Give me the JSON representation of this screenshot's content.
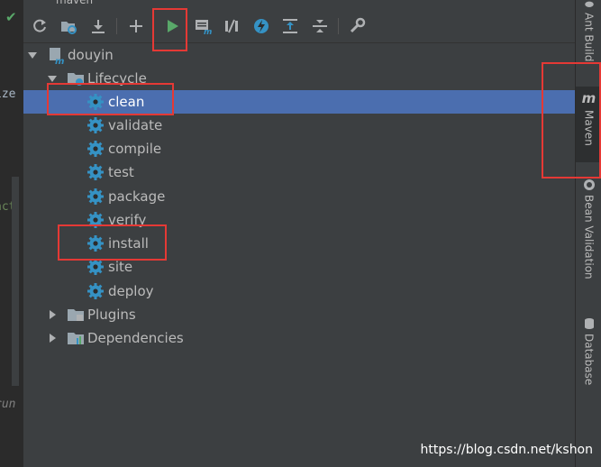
{
  "window_title": "maven",
  "editor_fragments": [
    "ize",
    "act",
    "run"
  ],
  "toolbar": {
    "buttons": [
      {
        "name": "reimport-all-maven-projects",
        "icon": "refresh-icon"
      },
      {
        "name": "generate-sources-and-update-folders",
        "icon": "folder-refresh-icon"
      },
      {
        "name": "download-sources",
        "icon": "download-icon"
      },
      {
        "name": "add-maven-projects",
        "icon": "plus-icon"
      },
      {
        "name": "run-maven-build",
        "icon": "play-icon"
      },
      {
        "name": "execute-maven-goal",
        "icon": "maven-goal-icon"
      },
      {
        "name": "toggle-offline-mode",
        "icon": "offline-icon"
      },
      {
        "name": "skip-tests",
        "icon": "lightning-icon"
      },
      {
        "name": "show-dependencies",
        "icon": "expand-all-icon"
      },
      {
        "name": "collapse-all",
        "icon": "collapse-all-icon"
      },
      {
        "name": "maven-settings",
        "icon": "wrench-icon"
      }
    ]
  },
  "tree": {
    "project": "douyin",
    "lifecycle_label": "Lifecycle",
    "goals": [
      "clean",
      "validate",
      "compile",
      "test",
      "package",
      "verify",
      "install",
      "site",
      "deploy"
    ],
    "selected_goal": "clean",
    "plugins_label": "Plugins",
    "dependencies_label": "Dependencies"
  },
  "side_tabs": [
    {
      "label": "Ant Build",
      "active": false
    },
    {
      "label": "Maven",
      "active": true
    },
    {
      "label": "Bean Validation",
      "active": false
    },
    {
      "label": "Database",
      "active": false
    }
  ],
  "watermark": "https://blog.csdn.net/kshon",
  "colors": {
    "selection": "#4b6eaf",
    "gear": "#3592c4",
    "run_green": "#59a869",
    "annotation_red": "#e53935"
  }
}
